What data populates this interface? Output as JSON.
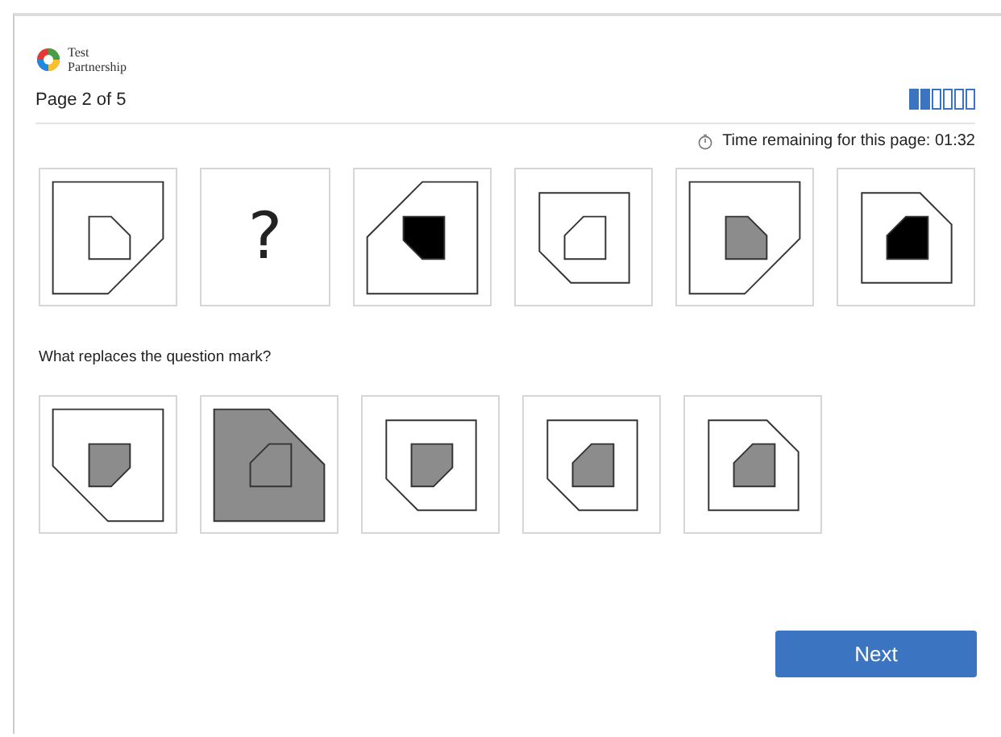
{
  "brand": {
    "line_1": "Test",
    "line_2": "Partnership"
  },
  "page_label": "Page 2 of 5",
  "progress": [
    {
      "filled": true
    },
    {
      "filled": true
    },
    {
      "filled": false
    },
    {
      "filled": false
    },
    {
      "filled": false
    },
    {
      "filled": false
    }
  ],
  "timer": "Time remaining for this page: 01:32",
  "sequence": [
    {
      "kind": "figure"
    },
    {
      "kind": "question",
      "text": "?"
    },
    {
      "kind": "figure"
    },
    {
      "kind": "figure"
    },
    {
      "kind": "figure"
    },
    {
      "kind": "figure"
    }
  ],
  "prompt": "What replaces the question mark?",
  "answers": [
    {
      "kind": "figure"
    },
    {
      "kind": "figure"
    },
    {
      "kind": "figure"
    },
    {
      "kind": "figure"
    },
    {
      "kind": "figure"
    }
  ],
  "next_button": "Next"
}
